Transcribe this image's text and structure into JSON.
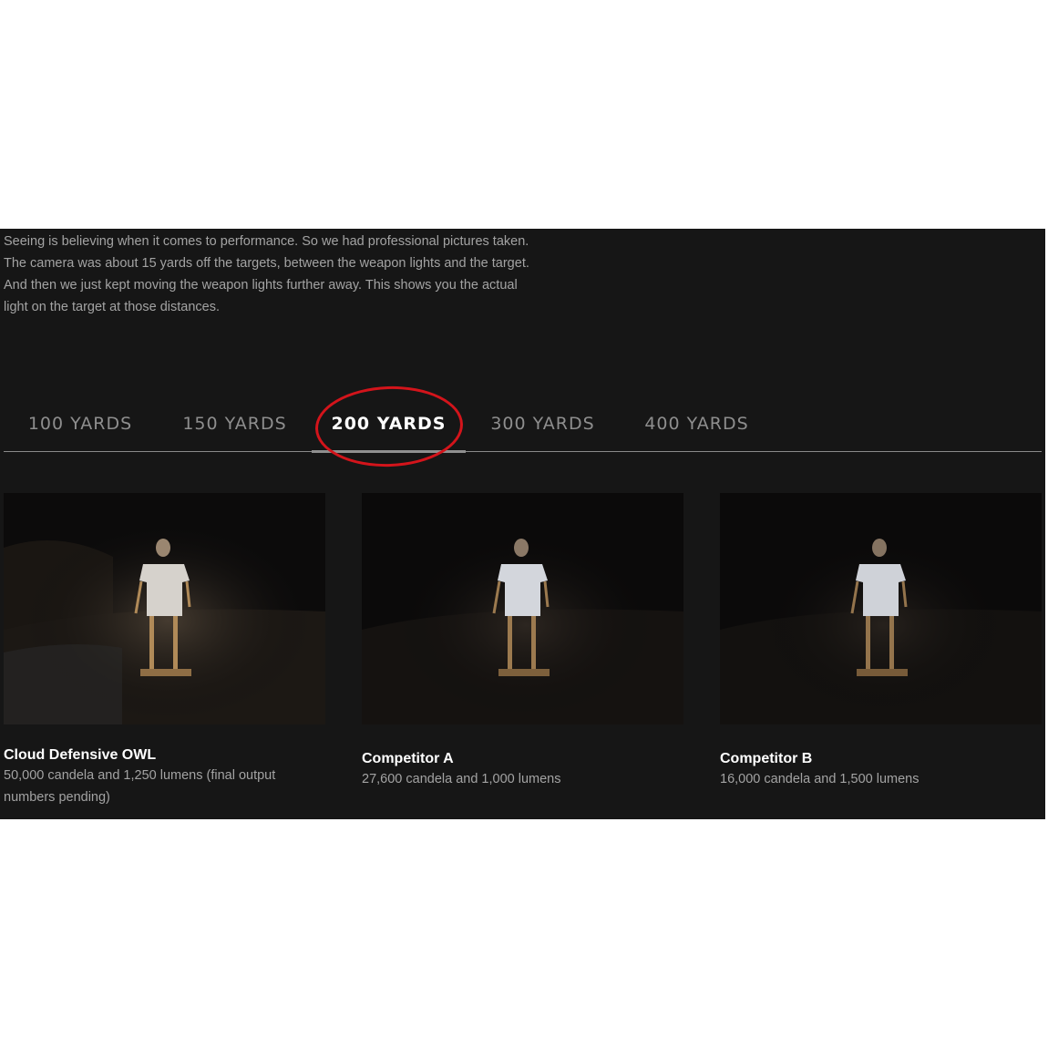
{
  "intro": {
    "text": "Seeing is believing when it comes to performance. So we had professional pictures taken. The camera was about 15 yards off the targets, between the weapon lights and the target. And then we just kept moving the weapon lights further away. This shows you the actual light on the target at those distances."
  },
  "tabs": [
    {
      "label": "100 YARDS",
      "active": false
    },
    {
      "label": "150 YARDS",
      "active": false
    },
    {
      "label": "200 YARDS",
      "active": true
    },
    {
      "label": "300 YARDS",
      "active": false
    },
    {
      "label": "400 YARDS",
      "active": false
    }
  ],
  "cards": [
    {
      "title": "Cloud Defensive OWL",
      "description": "50,000 candela and 1,250 lumens (final output numbers pending)"
    },
    {
      "title": "Competitor A",
      "description": "27,600 candela and 1,000 lumens"
    },
    {
      "title": "Competitor B",
      "description": "16,000 candela and 1,500 lumens"
    }
  ],
  "colors": {
    "panel_background": "#161616",
    "active_tab_text": "#ffffff",
    "inactive_tab_text": "#8e8e8e",
    "highlight_ring": "#d3141b"
  }
}
